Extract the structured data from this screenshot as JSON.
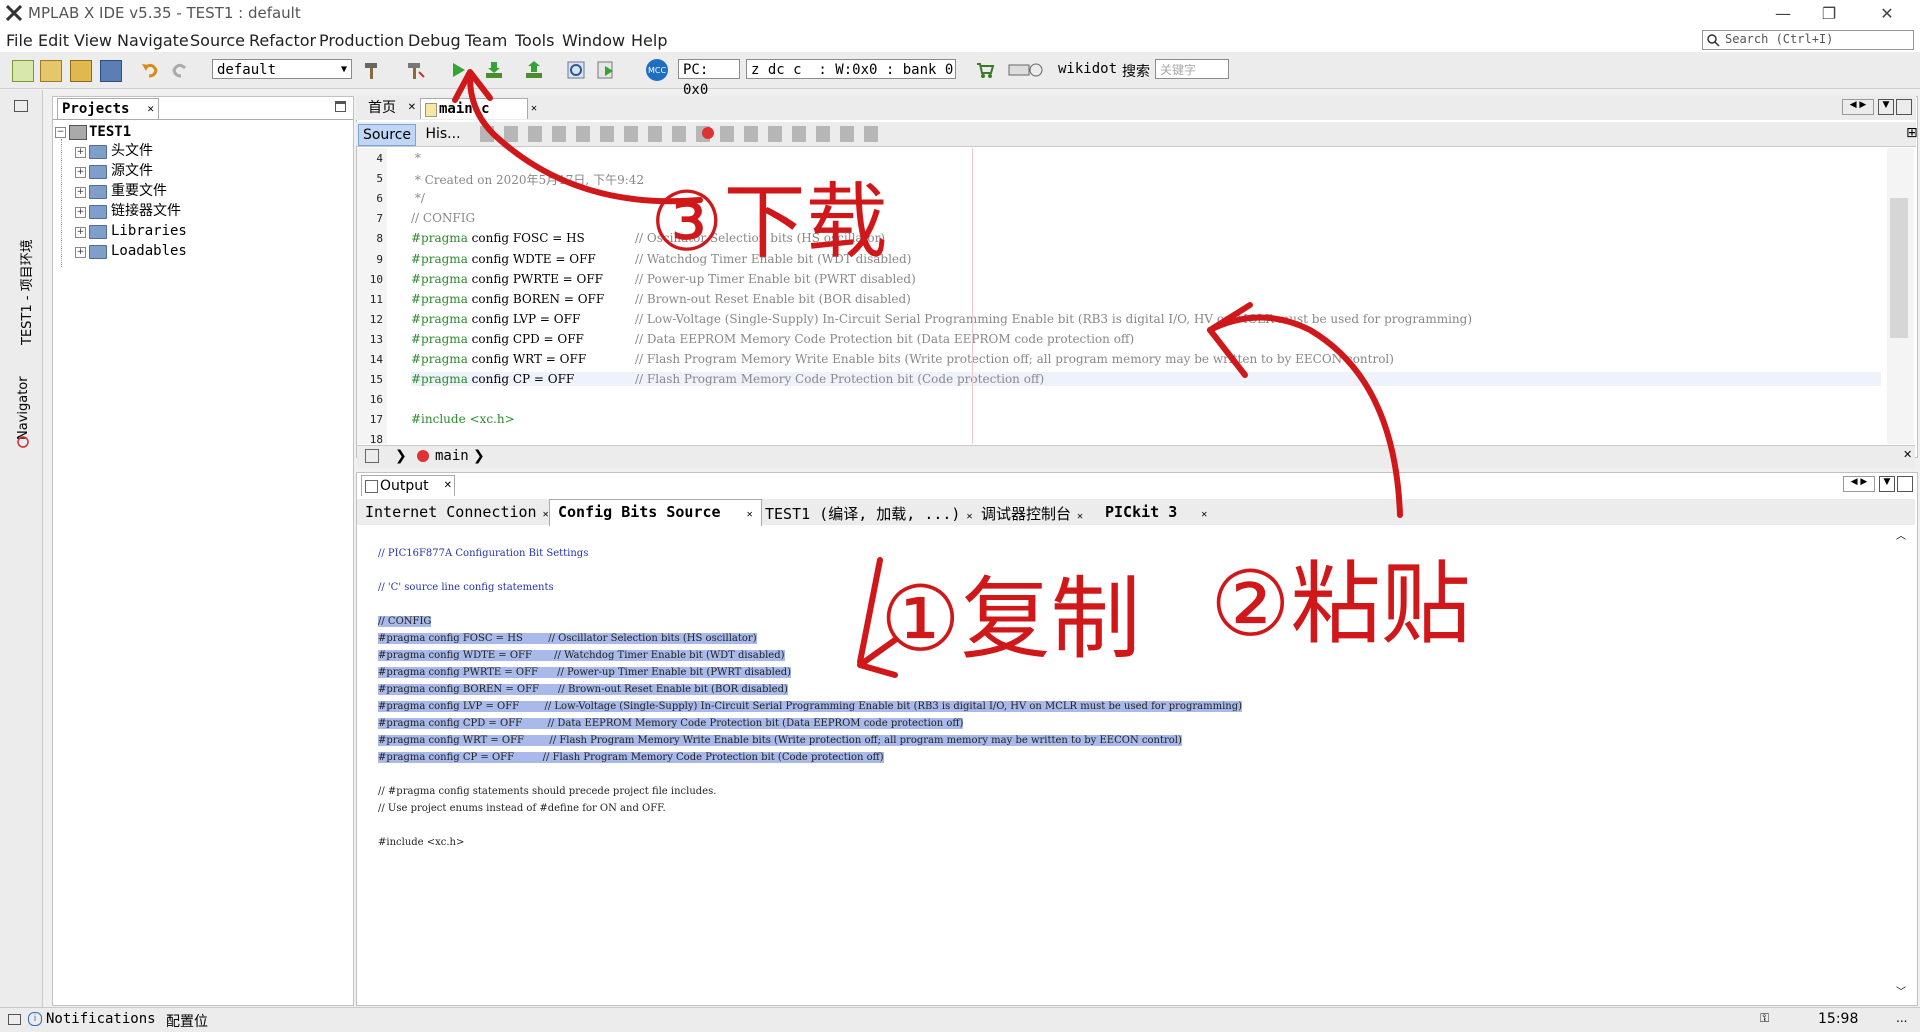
{
  "window": {
    "title": "MPLAB X IDE v5.35 - TEST1 : default"
  },
  "menu": [
    "File",
    "Edit",
    "View",
    "Navigate",
    "Source",
    "Refactor",
    "Production",
    "Debug",
    "Team",
    "Tools",
    "Window",
    "Help"
  ],
  "search": {
    "placeholder": "Search (Ctrl+I)"
  },
  "toolbar": {
    "config_combo": "default",
    "pc": "PC: 0x0",
    "status": "z dc c  : W:0x0 : bank 0",
    "wikidot": "wikidot",
    "search_label": "搜索",
    "keyword_placeholder": "关键字"
  },
  "left_strip": {
    "project_env": "TEST1 - 项目环境",
    "navigator": "Navigator"
  },
  "projects": {
    "tab": "Projects",
    "root": "TEST1",
    "items": [
      "头文件",
      "源文件",
      "重要文件",
      "链接器文件",
      "Libraries",
      "Loadables"
    ]
  },
  "editor": {
    "tabs": [
      "首页",
      "main.c"
    ],
    "subtabs": [
      "Source",
      "His..."
    ],
    "lines": [
      {
        "n": "4",
        "text": " *"
      },
      {
        "n": "5",
        "text": " * Created on 2020年5月17日, 下午9:42"
      },
      {
        "n": "6",
        "text": " */"
      },
      {
        "n": "7",
        "text": "// CONFIG"
      },
      {
        "n": "8",
        "kw": "#pragma",
        "rest": " config FOSC = HS",
        "comment": "// Oscillator Selection bits (HS oscillator)"
      },
      {
        "n": "9",
        "kw": "#pragma",
        "rest": " config WDTE = OFF",
        "comment": "// Watchdog Timer Enable bit (WDT disabled)"
      },
      {
        "n": "10",
        "kw": "#pragma",
        "rest": " config PWRTE = OFF",
        "comment": "// Power-up Timer Enable bit (PWRT disabled)"
      },
      {
        "n": "11",
        "kw": "#pragma",
        "rest": " config BOREN = OFF",
        "comment": "// Brown-out Reset Enable bit (BOR disabled)"
      },
      {
        "n": "12",
        "kw": "#pragma",
        "rest": " config LVP = OFF",
        "comment": "// Low-Voltage (Single-Supply) In-Circuit Serial Programming Enable bit (RB3 is digital I/O, HV on MCLR must be used for programming)"
      },
      {
        "n": "13",
        "kw": "#pragma",
        "rest": " config CPD = OFF",
        "comment": "// Data EEPROM Memory Code Protection bit (Data EEPROM code protection off)"
      },
      {
        "n": "14",
        "kw": "#pragma",
        "rest": " config WRT = OFF",
        "comment": "// Flash Program Memory Write Enable bits (Write protection off; all program memory may be written to by EECON control)"
      },
      {
        "n": "15",
        "kw": "#pragma",
        "rest": " config CP = OFF",
        "comment": "// Flash Program Memory Code Protection bit (Code protection off)"
      },
      {
        "n": "16",
        "text": ""
      },
      {
        "n": "17",
        "text": "#include <xc.h>"
      },
      {
        "n": "18",
        "text": ""
      }
    ],
    "breadcrumb": "main"
  },
  "output": {
    "tab": "Output",
    "tabs": [
      "Internet Connection",
      "Config Bits Source",
      "TEST1 (编译, 加载, ...)",
      "调试器控制台",
      "PICkit 3"
    ],
    "lines": [
      {
        "t": "// PIC16F877A Configuration Bit Settings",
        "style": "bl"
      },
      {
        "t": "",
        "style": ""
      },
      {
        "t": "// 'C' source line config statements",
        "style": "bl"
      },
      {
        "t": "",
        "style": ""
      },
      {
        "t": "// CONFIG",
        "style": "sel"
      },
      {
        "t": "#pragma config FOSC = HS        // Oscillator Selection bits (HS oscillator)",
        "style": "sel"
      },
      {
        "t": "#pragma config WDTE = OFF       // Watchdog Timer Enable bit (WDT disabled)",
        "style": "sel"
      },
      {
        "t": "#pragma config PWRTE = OFF      // Power-up Timer Enable bit (PWRT disabled)",
        "style": "sel"
      },
      {
        "t": "#pragma config BOREN = OFF      // Brown-out Reset Enable bit (BOR disabled)",
        "style": "sel"
      },
      {
        "t": "#pragma config LVP = OFF        // Low-Voltage (Single-Supply) In-Circuit Serial Programming Enable bit (RB3 is digital I/O, HV on MCLR must be used for programming)",
        "style": "sel"
      },
      {
        "t": "#pragma config CPD = OFF        // Data EEPROM Memory Code Protection bit (Data EEPROM code protection off)",
        "style": "sel"
      },
      {
        "t": "#pragma config WRT = OFF        // Flash Program Memory Write Enable bits (Write protection off; all program memory may be written to by EECON control)",
        "style": "sel"
      },
      {
        "t": "#pragma config CP = OFF         // Flash Program Memory Code Protection bit (Code protection off)",
        "style": "sel"
      },
      {
        "t": "",
        "style": ""
      },
      {
        "t": "// #pragma config statements should precede project file includes.",
        "style": ""
      },
      {
        "t": "// Use project enums instead of #define for ON and OFF.",
        "style": ""
      },
      {
        "t": "",
        "style": ""
      },
      {
        "t": "#include <xc.h>",
        "style": ""
      }
    ]
  },
  "status": {
    "notifications": "Notifications",
    "config_bits": "配置位",
    "position": "15:98",
    "insert": "..."
  },
  "annotations": {
    "download": "③下载",
    "copy": "①复制",
    "paste": "②粘贴"
  },
  "colors": {
    "annotation": "#d0181b",
    "selection": "#a8b9ea",
    "pragma": "#2b8a2b"
  }
}
